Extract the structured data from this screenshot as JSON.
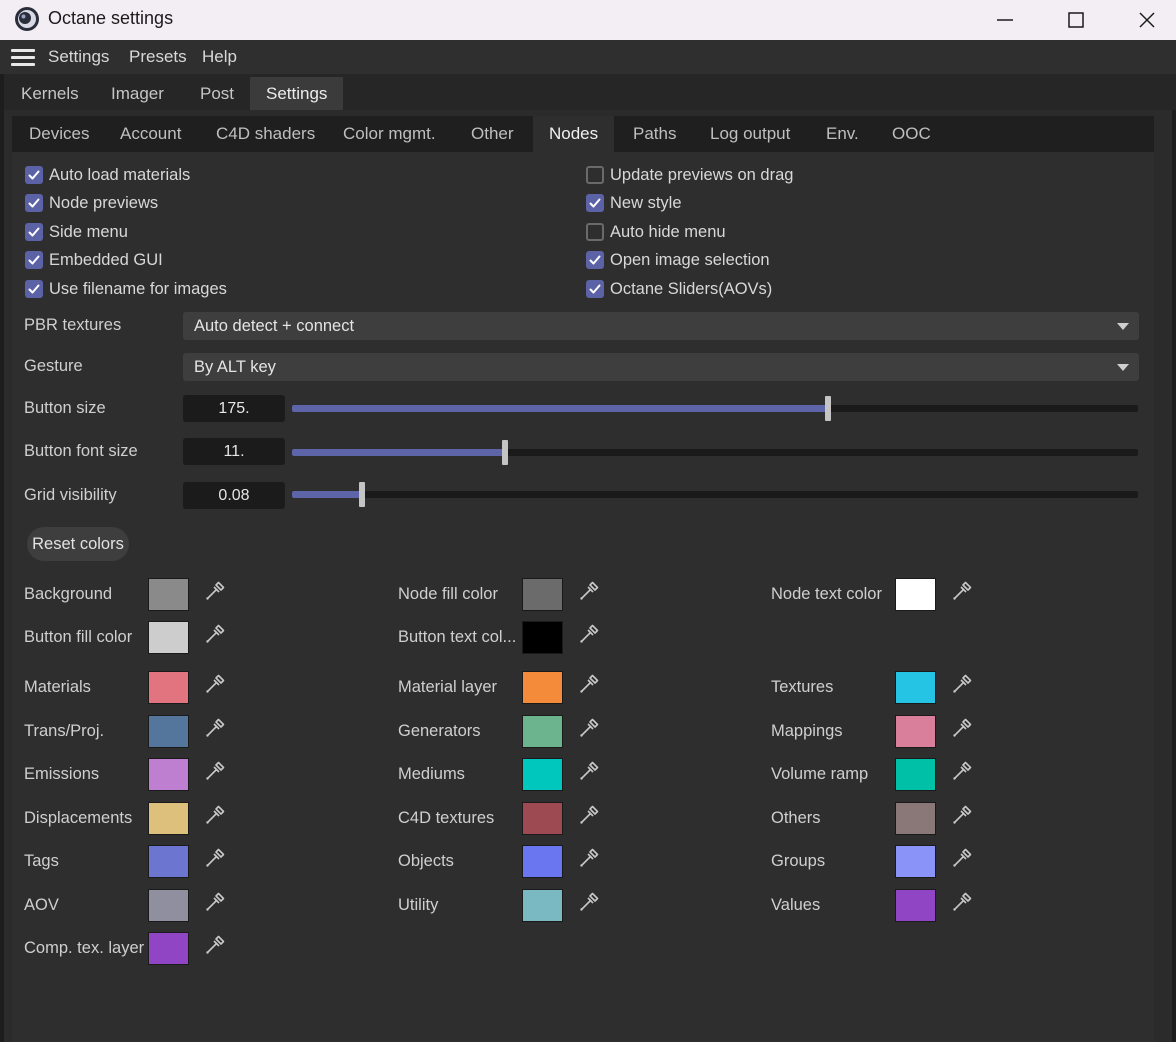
{
  "window": {
    "title": "Octane settings"
  },
  "menu": {
    "items": [
      "Settings",
      "Presets",
      "Help"
    ]
  },
  "main_tabs": {
    "items": [
      "Kernels",
      "Imager",
      "Post",
      "Settings"
    ],
    "active": "Settings"
  },
  "sub_tabs": {
    "items": [
      "Devices",
      "Account",
      "C4D shaders",
      "Color mgmt.",
      "Other",
      "Nodes",
      "Paths",
      "Log output",
      "Env.",
      "OOC"
    ],
    "active": "Nodes"
  },
  "checkboxes_left": [
    {
      "label": "Auto load materials",
      "checked": true
    },
    {
      "label": "Node previews",
      "checked": true
    },
    {
      "label": "Side menu",
      "checked": true
    },
    {
      "label": "Embedded GUI",
      "checked": true
    },
    {
      "label": "Use filename for images",
      "checked": true
    }
  ],
  "checkboxes_right": [
    {
      "label": "Update previews on drag",
      "checked": false
    },
    {
      "label": "New style",
      "checked": true
    },
    {
      "label": "Auto hide menu",
      "checked": false
    },
    {
      "label": "Open image selection",
      "checked": true
    },
    {
      "label": "Octane Sliders(AOVs)",
      "checked": true
    }
  ],
  "pbr": {
    "label": "PBR textures",
    "value": "Auto detect + connect"
  },
  "gesture": {
    "label": "Gesture",
    "value": "By ALT key"
  },
  "sliders": [
    {
      "label": "Button size",
      "value": "175.",
      "fraction": 0.633
    },
    {
      "label": "Button font size",
      "value": "11.",
      "fraction": 0.252
    },
    {
      "label": "Grid visibility",
      "value": "0.08",
      "fraction": 0.083
    }
  ],
  "reset_colors": "Reset colors",
  "colors": [
    [
      {
        "label": "Background",
        "color": "#8a8a8a"
      },
      {
        "label": "Node fill color",
        "color": "#6b6b6b"
      },
      {
        "label": "Node text color",
        "color": "#ffffff"
      }
    ],
    [
      {
        "label": "Button fill color",
        "color": "#cdcdcd"
      },
      {
        "label": "Button text col...",
        "color": "#000000"
      },
      null
    ],
    [
      {
        "label": "Materials",
        "color": "#e2747f"
      },
      {
        "label": "Material layer",
        "color": "#f48b3b"
      },
      {
        "label": "Textures",
        "color": "#26c4e4"
      }
    ],
    [
      {
        "label": "Trans/Proj.",
        "color": "#55769c"
      },
      {
        "label": "Generators",
        "color": "#6cb48d"
      },
      {
        "label": "Mappings",
        "color": "#d97f9b"
      }
    ],
    [
      {
        "label": "Emissions",
        "color": "#bf7fd0"
      },
      {
        "label": "Mediums",
        "color": "#00c7be"
      },
      {
        "label": "Volume ramp",
        "color": "#00c0a8"
      }
    ],
    [
      {
        "label": "Displacements",
        "color": "#dcc07c"
      },
      {
        "label": "C4D textures",
        "color": "#9e4a53"
      },
      {
        "label": "Others",
        "color": "#8a7878"
      }
    ],
    [
      {
        "label": "Tags",
        "color": "#6c75cf"
      },
      {
        "label": "Objects",
        "color": "#6a75f0"
      },
      {
        "label": "Groups",
        "color": "#8a93f8"
      }
    ],
    [
      {
        "label": "AOV",
        "color": "#8f8f9f"
      },
      {
        "label": "Utility",
        "color": "#7bb9c2"
      },
      {
        "label": "Values",
        "color": "#9045c4"
      }
    ],
    [
      {
        "label": "Comp. tex. layer",
        "color": "#9045c4"
      },
      null,
      null
    ]
  ]
}
